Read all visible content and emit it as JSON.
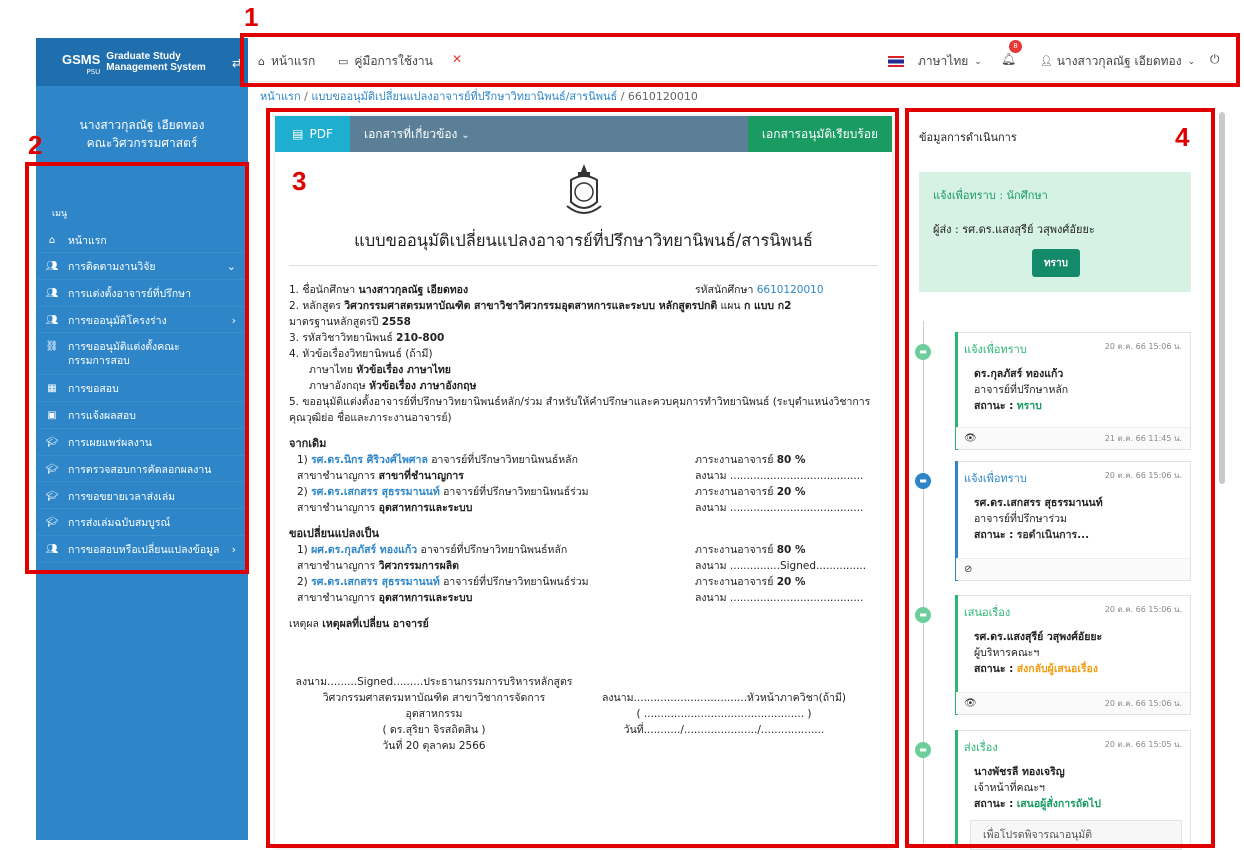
{
  "callouts": [
    "1",
    "2",
    "3",
    "4"
  ],
  "sidebar": {
    "brand": {
      "logo": "GSMS",
      "logo_sub": "PSU",
      "name_line1": "Graduate Study",
      "name_line2": "Management System",
      "toggle_icon": "swap-icon"
    },
    "user_name": "นางสาวกุลณัฐ เอียดทอง",
    "faculty": "คณะวิศวกรรมศาสตร์",
    "menu_label": "เมนู",
    "items": [
      {
        "label": "หน้าแรก",
        "icon": "home-icon"
      },
      {
        "label": "การติดตามงานวิจัย",
        "icon": "user-group-icon",
        "chevron": "⌄"
      },
      {
        "label": "การแต่งตั้งอาจารย์ที่ปรึกษา",
        "icon": "users-icon"
      },
      {
        "label": "การขออนุมัติโครงร่าง",
        "icon": "user-group-icon",
        "chevron": "›"
      },
      {
        "label": "การขออนุมัติแต่งตั้งคณะกรรมการสอบ",
        "icon": "sitemap-icon"
      },
      {
        "label": "การขอสอบ",
        "icon": "calendar-icon"
      },
      {
        "label": "การแจ้งผลสอบ",
        "icon": "save-icon"
      },
      {
        "label": "การเผยแพร่ผลงาน",
        "icon": "graduation-cap-icon"
      },
      {
        "label": "การตรวจสอบการคัดลอกผลงาน",
        "icon": "graduation-cap-icon"
      },
      {
        "label": "การขอขยายเวลาส่งเล่ม",
        "icon": "graduation-cap-icon"
      },
      {
        "label": "การส่งเล่มฉบับสมบูรณ์",
        "icon": "graduation-cap-icon"
      },
      {
        "label": "การขอสอบหรือเปลี่ยนแปลงข้อมูล",
        "icon": "user-group-icon",
        "chevron": "›"
      }
    ]
  },
  "topbar": {
    "home": "หน้าแรก",
    "manual": "คู่มือการใช้งาน",
    "language": "ภาษาไทย",
    "notification_count": "8",
    "user": "นางสาวกุลณัฐ เอียดทอง"
  },
  "breadcrumb": {
    "home": "หน้าแรก",
    "page": "แบบขออนุมัติเปลี่ยนแปลงอาจารย์ที่ปรึกษาวิทยานิพนธ์/สารนิพนธ์",
    "id": "6610120010"
  },
  "doc_toolbar": {
    "pdf": "PDF",
    "related": "เอกสารที่เกี่ยวข้อง",
    "approved": "เอกสารอนุมัติเรียบร้อย"
  },
  "doc": {
    "title": "แบบขออนุมัติเปลี่ยนแปลงอาจารย์ที่ปรึกษาวิทยานิพนธ์/สารนิพนธ์",
    "l1_label": "1. ชื่อนักศึกษา",
    "l1_value": "นางสาวกุลณัฐ เอียดทอง",
    "sid_label": "รหัสนักศึกษา",
    "sid_value": "6610120010",
    "l2_label": "2. หลักสูตร",
    "l2_value": "วิศวกรรมศาสตรมหาบัณฑิต สาขาวิชาวิศวกรรมอุตสาหการและระบบ หลักสูตรปกติ",
    "l2_plan_label": "แผน",
    "l2_plan": "ก แบบ ก2",
    "l2b_label": "มาตรฐานหลักสูตรปี",
    "l2b_value": "2558",
    "l3_label": "3. รหัสวิชาวิทยานิพนธ์",
    "l3_value": "210-800",
    "l4": "4. หัวข้อเรื่องวิทยานิพนธ์ (ถ้ามี)",
    "l4_th_label": "ภาษาไทย",
    "l4_th": "หัวข้อเรื่อง ภาษาไทย",
    "l4_en_label": "ภาษาอังกฤษ",
    "l4_en": "หัวข้อเรื่อง ภาษาอังกฤษ",
    "l5": "5. ขออนุมัติแต่งตั้งอาจารย์ที่ปรึกษาวิทยานิพนธ์หลัก/ร่วม สำหรับให้คำปรึกษาและควบคุมการทำวิทยานิพนธ์ (ระบุตำแหน่งวิชาการ คุณวุฒิย่อ ชื่อและภาระงานอาจารย์)",
    "from_h": "จากเดิม",
    "from": [
      {
        "idx": "1)",
        "name": "รศ.ดร.นิกร ศิริวงศ์ไพศาล",
        "role": "อาจารย์ที่ปรึกษาวิทยานิพนธ์หลัก",
        "load_label": "ภาระงานอาจารย์",
        "load": "80 %",
        "field_label": "สาขาชำนาญการ",
        "field": "สาขาที่ชำนาญการ",
        "sign_label": "ลงนาม",
        "sign": "........................................"
      },
      {
        "idx": "2)",
        "name": "รศ.ดร.เสกสรร สุธรรมานนท์",
        "role": "อาจารย์ที่ปรึกษาวิทยานิพนธ์ร่วม",
        "load_label": "ภาระงานอาจารย์",
        "load": "20 %",
        "field_label": "สาขาชำนาญการ",
        "field": "อุตสาหการและระบบ",
        "sign_label": "ลงนาม",
        "sign": "........................................"
      }
    ],
    "to_h": "ขอเปลี่ยนแปลงเป็น",
    "to": [
      {
        "idx": "1)",
        "name": "ผศ.ดร.กุลภัสร์ ทองแก้ว",
        "role": "อาจารย์ที่ปรึกษาวิทยานิพนธ์หลัก",
        "load_label": "ภาระงานอาจารย์",
        "load": "80 %",
        "field_label": "สาขาชำนาญการ",
        "field": "วิศวกรรมการผลิต",
        "sign_label": "ลงนาม",
        "sign": "...............Signed..............."
      },
      {
        "idx": "2)",
        "name": "รศ.ดร.เสกสรร สุธรรมานนท์",
        "role": "อาจารย์ที่ปรึกษาวิทยานิพนธ์ร่วม",
        "load_label": "ภาระงานอาจารย์",
        "load": "20 %",
        "field_label": "สาขาชำนาญการ",
        "field": "อุตสาหการและระบบ",
        "sign_label": "ลงนาม",
        "sign": "........................................"
      }
    ],
    "reason_label": "เหตุผล",
    "reason": "เหตุผลที่เปลี่ยน อาจารย์",
    "sign_left": [
      "ลงนาม.........Signed.........ประธานกรรมการบริหารหลักสูตร",
      "วิศวกรรมศาสตรมหาบัณฑิต สาขาวิชาการจัดการ",
      "อุตสาหกรรม",
      "( ดร.สุริยา จิรสถิตสิน )",
      "วันที่ 20 ตุลาคม 2566"
    ],
    "sign_right": [
      "ลงนาม..................................หัวหน้าภาควิชา(ถ้ามี)",
      "( ................................................ )",
      "วันที่.........../....................../..................."
    ]
  },
  "rightpanel": {
    "title": "ข้อมูลการดำเนินการ",
    "notice_line1": "แจ้งเพื่อทราบ : นักศึกษา",
    "notice_line2": "ผู้ส่ง : รศ.ดร.แสงสุรีย์ วสุพงศ์อัยยะ",
    "ack_button": "ทราบ",
    "cards": [
      {
        "type": "แจ้งเพื่อทราบ",
        "time": "20 ต.ค. 66 15:06 น.",
        "name": "ดร.กุลภัสร์ ทองแก้ว",
        "role": "อาจารย์ที่ปรึกษาหลัก",
        "status_label": "สถานะ :",
        "status": "ทราบ",
        "footer_icon": "eye-icon",
        "footer_time": "21 ต.ค. 66 11:45 น."
      },
      {
        "type": "แจ้งเพื่อทราบ",
        "time": "20 ต.ค. 66 15:06 น.",
        "name": "รศ.ดร.เสกสรร สุธรรมานนท์",
        "role": "อาจารย์ที่ปรึกษาร่วม",
        "status_label": "สถานะ :",
        "status": "รอดำเนินการ...",
        "footer_icon": "eye-slash-icon",
        "footer_time": ""
      },
      {
        "type": "เสนอเรื่อง",
        "time": "20 ต.ค. 66 15:06 น.",
        "name": "รศ.ดร.แสงสุรีย์ วสุพงศ์อัยยะ",
        "role": "ผู้บริหารคณะฯ",
        "status_label": "สถานะ :",
        "status": "ส่งกลับผู้เสนอเรื่อง",
        "footer_icon": "eye-icon",
        "footer_time": "20 ต.ค. 66 15:06 น."
      },
      {
        "type": "ส่งเรื่อง",
        "time": "20 ต.ค. 66 15:05 น.",
        "name": "นางพัชรลี ทองเจริญ",
        "role": "เจ้าหน้าที่คณะฯ",
        "status_label": "สถานะ :",
        "status": "เสนอผู้สั่งการถัดไป",
        "note": "เพื่อโปรดพิจารณาอนุมัติ"
      }
    ]
  },
  "colors": {
    "sidebar": "#2e86c9",
    "accent_green": "#1a9b62",
    "callout_red": "#e00000",
    "status_orange": "#f39c12",
    "link_blue": "#2e86c9"
  }
}
